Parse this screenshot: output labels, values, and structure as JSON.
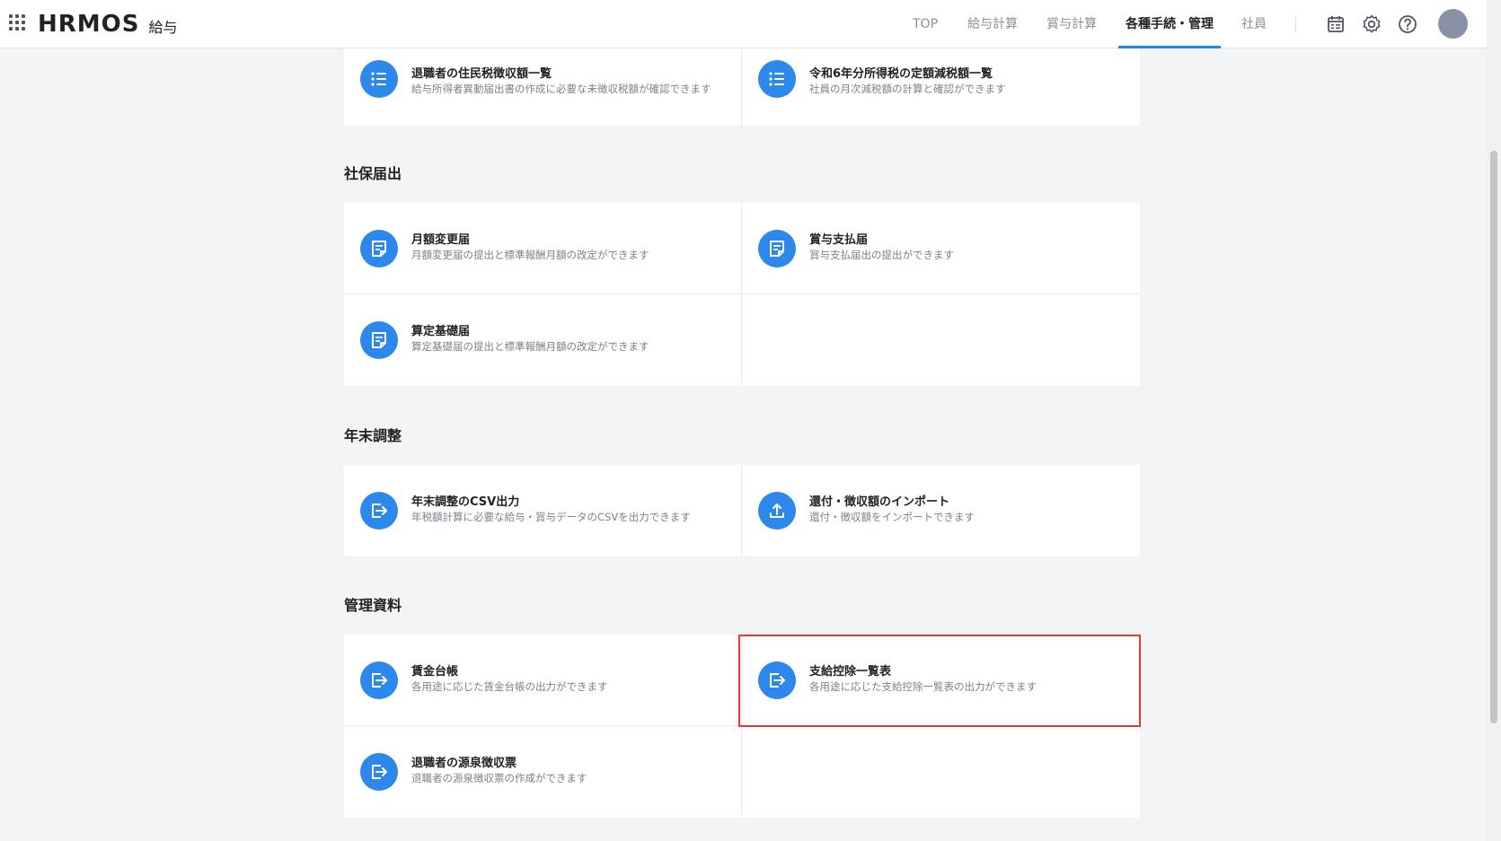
{
  "header": {
    "logo_main": "HRMOS",
    "logo_sub": "給与",
    "tabs": [
      {
        "label": "TOP"
      },
      {
        "label": "給与計算"
      },
      {
        "label": "賞与計算"
      },
      {
        "label": "各種手続・管理",
        "active": true
      },
      {
        "label": "社員"
      }
    ],
    "icons": [
      "calendar-icon",
      "gear-icon",
      "help-icon"
    ]
  },
  "sections": {
    "top_partial": {
      "cards": [
        {
          "title": "退職者の住民税徴収額一覧",
          "desc": "給与所得者異動届出書の作成に必要な未徴収税額が確認できます",
          "icon": "list-icon"
        },
        {
          "title": "令和6年分所得税の定額減税額一覧",
          "desc": "社員の月次減税額の計算と確認ができます",
          "icon": "list-icon"
        }
      ]
    },
    "shaho": {
      "title": "社保届出",
      "cards": [
        {
          "title": "月額変更届",
          "desc": "月額変更届の提出と標準報酬月額の改定ができます",
          "icon": "document-icon"
        },
        {
          "title": "賞与支払届",
          "desc": "賞与支払届出の提出ができます",
          "icon": "document-icon"
        },
        {
          "title": "算定基礎届",
          "desc": "算定基礎届の提出と標準報酬月額の改定ができます",
          "icon": "document-icon"
        }
      ]
    },
    "nenmatsu": {
      "title": "年末調整",
      "cards": [
        {
          "title": "年末調整のCSV出力",
          "desc": "年税額計算に必要な給与・賞与データのCSVを出力できます",
          "icon": "export-icon"
        },
        {
          "title": "還付・徴収額のインポート",
          "desc": "還付・徴収額をインポートできます",
          "icon": "upload-icon"
        }
      ]
    },
    "kanri": {
      "title": "管理資料",
      "cards": [
        {
          "title": "賃金台帳",
          "desc": "各用途に応じた賃金台帳の出力ができます",
          "icon": "export-icon"
        },
        {
          "title": "支給控除一覧表",
          "desc": "各用途に応じた支給控除一覧表の出力ができます",
          "icon": "export-icon"
        },
        {
          "title": "退職者の源泉徴収票",
          "desc": "退職者の源泉徴収票の作成ができます",
          "icon": "export-icon"
        }
      ]
    }
  },
  "colors": {
    "accent": "#2c88ea",
    "highlight": "#e53935"
  }
}
